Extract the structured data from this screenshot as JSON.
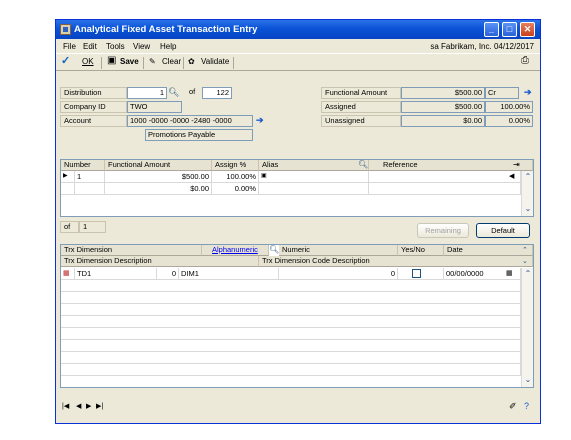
{
  "window": {
    "title": "Analytical Fixed Asset Transaction Entry"
  },
  "menu": {
    "items": [
      "File",
      "Edit",
      "Tools",
      "View",
      "Help"
    ],
    "status": "sa  Fabrikam, Inc.  04/12/2017"
  },
  "toolbar": {
    "ok": "OK",
    "save": "Save",
    "clear": "Clear",
    "validate": "Validate"
  },
  "header": {
    "distribution_label": "Distribution",
    "distribution_value": "1",
    "of_label": "of",
    "of_value": "122",
    "company_label": "Company ID",
    "company_value": "TWO",
    "account_label": "Account",
    "account_value": "1000 -0000 -0000 -2480 -0000",
    "account_desc": "Promotions Payable",
    "functional_label": "Functional Amount",
    "functional_value": "$500.00",
    "functional_cr": "Cr",
    "assigned_label": "Assigned",
    "assigned_value": "$500.00",
    "assigned_pct": "100.00%",
    "unassigned_label": "Unassigned",
    "unassigned_value": "$0.00",
    "unassigned_pct": "0.00%"
  },
  "grid1": {
    "headers": {
      "number": "Number",
      "functional": "Functional Amount",
      "assign": "Assign %",
      "alias": "Alias",
      "reference": "Reference"
    },
    "rows": [
      {
        "number": "1",
        "amount": "$500.00",
        "pct": "100.00%"
      },
      {
        "number": "",
        "amount": "$0.00",
        "pct": "0.00%"
      }
    ],
    "footer_of": "of",
    "footer_count": "1",
    "remaining": "Remaining",
    "default": "Default"
  },
  "grid2": {
    "headers": {
      "dimension": "Trx Dimension",
      "alphanumeric": "Alphanumeric",
      "numeric": "Numeric",
      "yesno": "Yes/No",
      "date": "Date",
      "dim_desc": "Trx Dimension Description",
      "code_desc": "Trx Dimension Code Description"
    },
    "row": {
      "dimension": "TD1",
      "value": "0",
      "alpha": "DIM1",
      "numeric": "0",
      "date": "00/00/0000"
    }
  }
}
